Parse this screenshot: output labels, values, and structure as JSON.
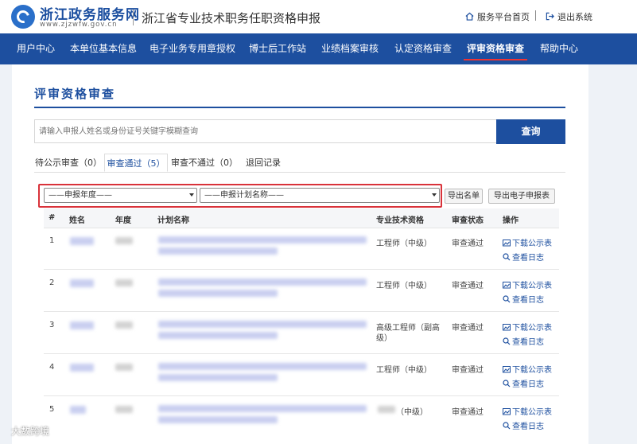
{
  "header": {
    "brand": "浙江政务服务网",
    "brand_url": "www.zjzwfw.gov.cn",
    "subtitle": "浙江省专业技术职务任职资格申报",
    "home_link": "服务平台首页",
    "logout_link": "退出系统"
  },
  "nav": {
    "items": [
      {
        "label": "用户中心"
      },
      {
        "label": "本单位基本信息"
      },
      {
        "label": "电子业务专用章授权"
      },
      {
        "label": "博士后工作站"
      },
      {
        "label": "业绩档案审核"
      },
      {
        "label": "认定资格审查"
      },
      {
        "label": "评审资格审查",
        "active": true
      },
      {
        "label": "帮助中心"
      }
    ]
  },
  "page": {
    "title": "评审资格审查",
    "search_placeholder": "请输入申报人姓名或身份证号关键字模糊查询",
    "search_button": "查询"
  },
  "tabs": [
    {
      "label": "待公示审查（0）"
    },
    {
      "label": "审查通过（5）",
      "active": true
    },
    {
      "label": "审查不通过（0）"
    },
    {
      "label": "退回记录"
    }
  ],
  "filters": {
    "year_select": "——申报年度——",
    "plan_select": "——申报计划名称——",
    "export_list": "导出名单",
    "export_form": "导出电子申报表"
  },
  "table": {
    "headers": [
      "#",
      "姓名",
      "年度",
      "计划名称",
      "专业技术资格",
      "审查状态",
      "操作"
    ],
    "rows": [
      {
        "index": "1",
        "qualification": "工程师（中级）",
        "qualification_line2": "",
        "status": "审查通过"
      },
      {
        "index": "2",
        "qualification": "工程师（中级）",
        "qualification_line2": "",
        "status": "审查通过"
      },
      {
        "index": "3",
        "qualification": "高级工程师（副高",
        "qualification_line2": "级）",
        "status": "审查通过"
      },
      {
        "index": "4",
        "qualification": "工程师（中级）",
        "qualification_line2": "",
        "status": "审查通过"
      },
      {
        "index": "5",
        "qualification": "（中级）",
        "qualification_line2": "",
        "status": "审查通过"
      }
    ],
    "action_download": "下载公示表",
    "action_log": "查看日志"
  },
  "watermark": "大数跨境",
  "colors": {
    "primary": "#1d4f9f",
    "highlight_border": "#d9323a",
    "active_nav_underline": "#e33"
  }
}
